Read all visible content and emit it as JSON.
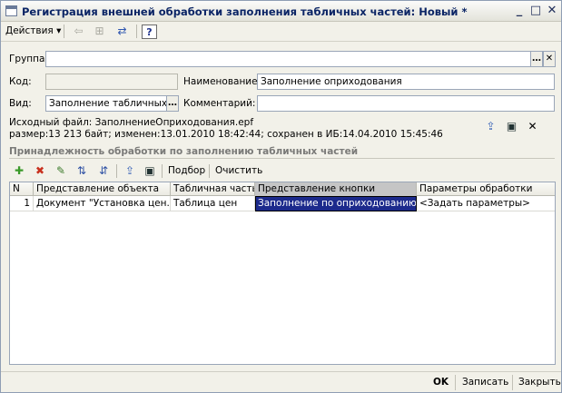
{
  "window": {
    "title": "Регистрация внешней обработки заполнения табличных частей: Новый *",
    "minimize": "_",
    "maximize": "□",
    "close": "✕"
  },
  "toolbar": {
    "actions_label": "Действия",
    "help_label": "?"
  },
  "form": {
    "group_label": "Группа:",
    "group_value": "",
    "code_label": "Код:",
    "code_value": "",
    "name_label": "Наименование:",
    "name_value": "Заполнение оприходования",
    "kind_label": "Вид:",
    "kind_value": "Заполнение табличных ч",
    "comment_label": "Комментарий:",
    "comment_value": ""
  },
  "file_info": {
    "line1": "Исходный файл: ЗаполнениеОприходования.epf",
    "line2": "размер:13 213 байт; изменен:13.01.2010 18:42:44; сохранен в ИБ:14.04.2010 15:45:46"
  },
  "section": {
    "title": "Принадлежность обработки по заполнению табличных частей",
    "select_label": "Подбор",
    "clear_label": "Очистить"
  },
  "table": {
    "columns": [
      "N",
      "Представление объекта",
      "Табличная часть",
      "Представление кнопки",
      "Параметры обработки"
    ],
    "rows": [
      {
        "n": "1",
        "object": "Документ \"Установка цен...",
        "tab_part": "Таблица цен",
        "button": "Заполнение по оприходованию",
        "params": "<Задать параметры>"
      }
    ]
  },
  "bottom": {
    "ok_label": "OK",
    "save_label": "Записать",
    "close_label": "Закрыть"
  }
}
